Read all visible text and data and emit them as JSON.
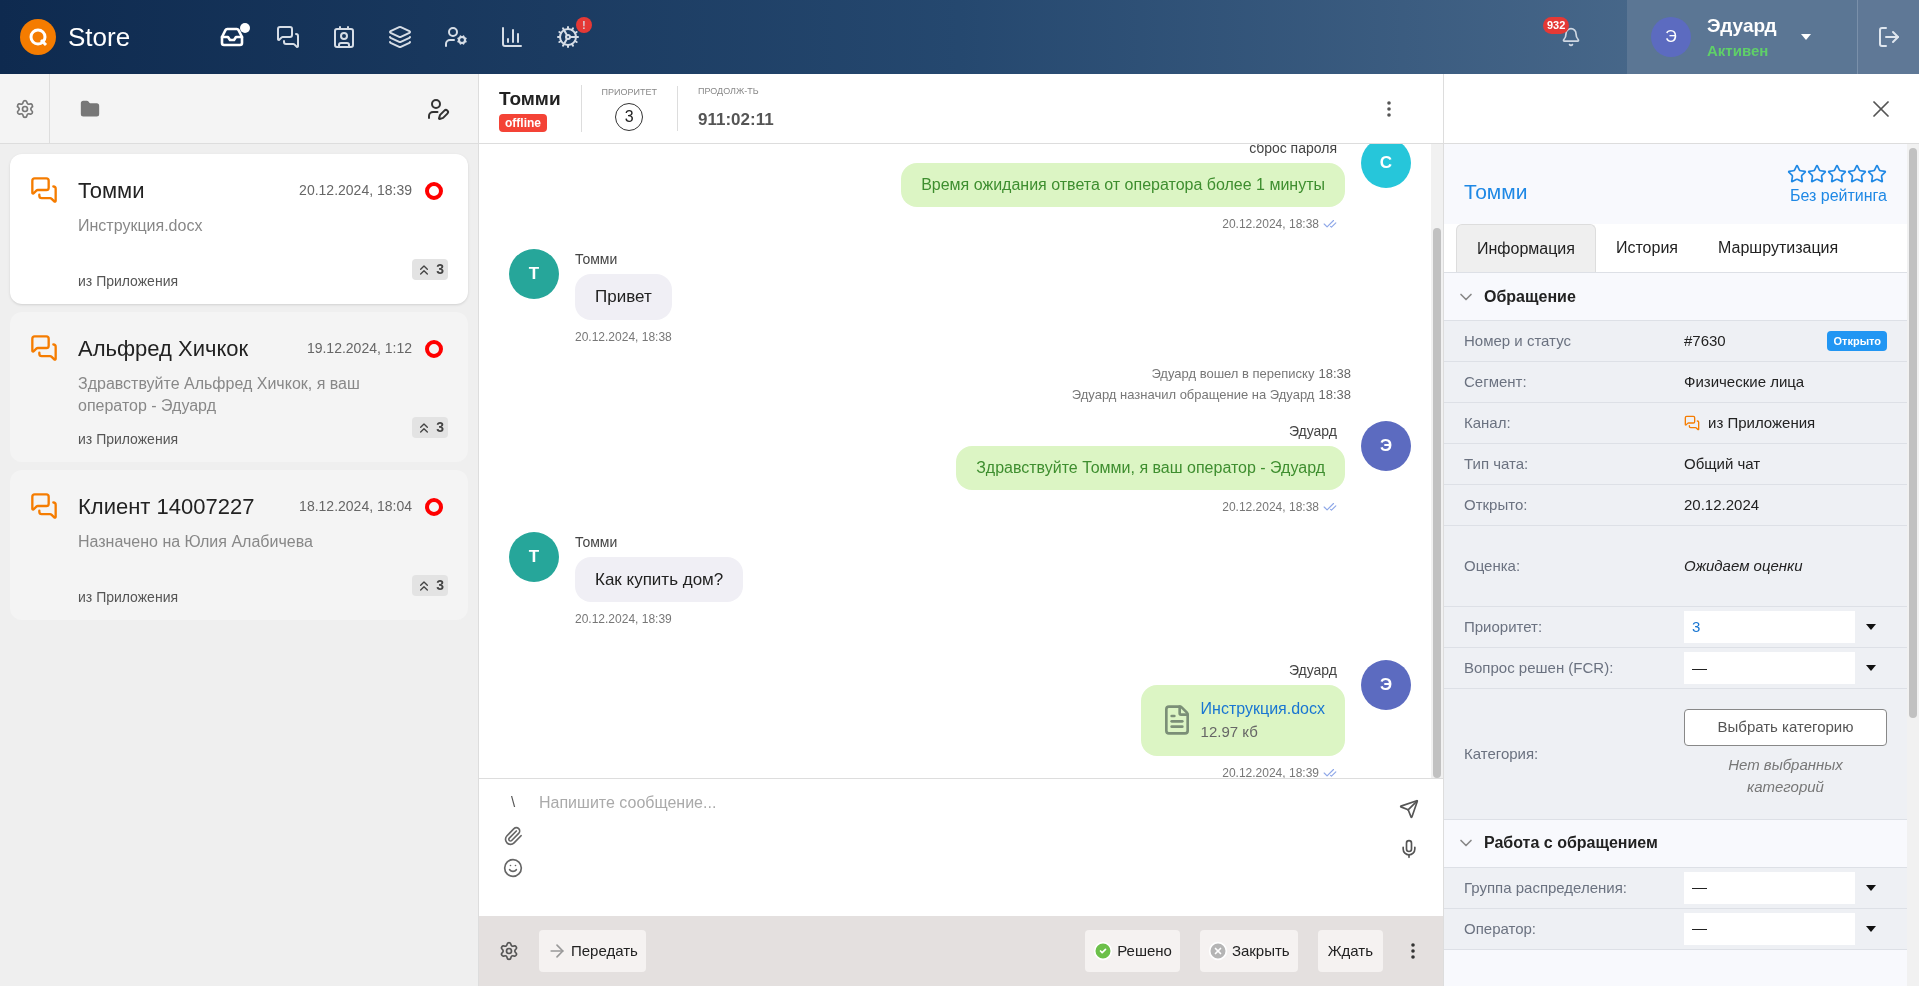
{
  "topbar": {
    "brand": "Store",
    "nav": [
      {
        "kind": "inbox",
        "selected": true,
        "dot": true
      },
      {
        "kind": "chats",
        "selected": false
      },
      {
        "kind": "contacts",
        "selected": false
      },
      {
        "kind": "layers",
        "selected": false
      },
      {
        "kind": "users",
        "selected": false
      },
      {
        "kind": "stats",
        "selected": false
      },
      {
        "kind": "settings",
        "selected": false,
        "badge": "!"
      }
    ],
    "notifications": "932",
    "user": {
      "initial": "Э",
      "name": "Эдуард",
      "status": "Активен"
    }
  },
  "chat_list": [
    {
      "name": "Томми",
      "time": "20.12.2024, 18:39",
      "preview": "Инструкция.docx",
      "channel": "из Приложения",
      "priority": "3",
      "selected": true
    },
    {
      "name": "Альфред Хичкок",
      "time": "19.12.2024, 1:12",
      "preview": "Здравствуйте Альфред Хичкок, я ваш оператор - Эдуард",
      "channel": "из Приложения",
      "priority": "3",
      "selected": false
    },
    {
      "name": "Клиент 14007227",
      "time": "18.12.2024, 18:04",
      "preview": "Назначено на Юлия Алабичева",
      "channel": "из Приложения",
      "priority": "3",
      "selected": false
    }
  ],
  "chat_header": {
    "name": "Томми",
    "presence": "offline",
    "priority_label": "ПРИОРИТЕТ",
    "priority": "3",
    "duration_label": "ПРОДОЛЖ-ТЬ",
    "duration": "911:02:11"
  },
  "messages": [
    {
      "kind": "outgoing",
      "author": "сброс пароля",
      "initial": "С",
      "color": "#26c6da",
      "text": "Время ожидания ответа от оператора более 1 минуты",
      "time": "20.12.2024, 18:38"
    },
    {
      "kind": "incoming",
      "author": "Томми",
      "initial": "Т",
      "color": "#26a69a",
      "text": "Привет",
      "time": "20.12.2024, 18:38"
    },
    {
      "kind": "system",
      "text": "Эдуард вошел в переписку",
      "time": "18:38"
    },
    {
      "kind": "system",
      "text": "Эдуард назначил обращение на Эдуард",
      "time": "18:38"
    },
    {
      "kind": "outgoing",
      "author": "Эдуард",
      "initial": "Э",
      "color": "#5c6bc0",
      "text": "Здравствуйте Томми, я ваш оператор - Эдуард",
      "time": "20.12.2024, 18:38"
    },
    {
      "kind": "incoming",
      "author": "Томми",
      "initial": "Т",
      "color": "#26a69a",
      "text": "Как купить дом?",
      "time": "20.12.2024, 18:39"
    },
    {
      "kind": "file",
      "author": "Эдуард",
      "initial": "Э",
      "color": "#5c6bc0",
      "text": "Инструкция.docx",
      "size": "12.97 кб",
      "time": "20.12.2024, 18:39"
    }
  ],
  "composer": {
    "quick_reply": "\\",
    "placeholder": "Напишите сообщение..."
  },
  "actions": {
    "transfer": "Передать",
    "resolved": "Решено",
    "close": "Закрыть",
    "wait": "Ждать"
  },
  "details": {
    "name": "Томми",
    "stars": 0,
    "rating": "Без рейтинга",
    "tabs": [
      {
        "label": "Информация",
        "selected": true
      },
      {
        "label": "История",
        "selected": false
      },
      {
        "label": "Маршрутизация",
        "selected": false
      }
    ],
    "sections": [
      {
        "title": "Обращение",
        "expanded": true,
        "rows": [
          {
            "kind": "status",
            "label": "Номер и статус",
            "value": "#7630",
            "badge": "Открыто"
          },
          {
            "kind": "text",
            "label": "Сегмент:",
            "value": "Физические лица"
          },
          {
            "kind": "channel",
            "label": "Канал:",
            "value": "из Приложения"
          },
          {
            "kind": "text",
            "label": "Тип чата:",
            "value": "Общий чат"
          },
          {
            "kind": "text",
            "label": "Открыто:",
            "value": "20.12.2024"
          },
          {
            "kind": "italic",
            "label": "Оценка:",
            "value": "Ожидаем оценки"
          },
          {
            "kind": "select",
            "label": "Приоритет:",
            "value": "3"
          },
          {
            "kind": "select",
            "label": "Вопрос решен (FCR):",
            "value": "—"
          },
          {
            "kind": "category",
            "label": "Категория:",
            "button": "Выбрать категорию",
            "value": "Нет выбранных категорий"
          }
        ]
      },
      {
        "title": "Работа с обращением",
        "expanded": true,
        "rows": [
          {
            "kind": "select",
            "label": "Группа распределения:",
            "value": "—"
          },
          {
            "kind": "select",
            "label": "Оператор:",
            "value": "—"
          }
        ]
      }
    ]
  }
}
